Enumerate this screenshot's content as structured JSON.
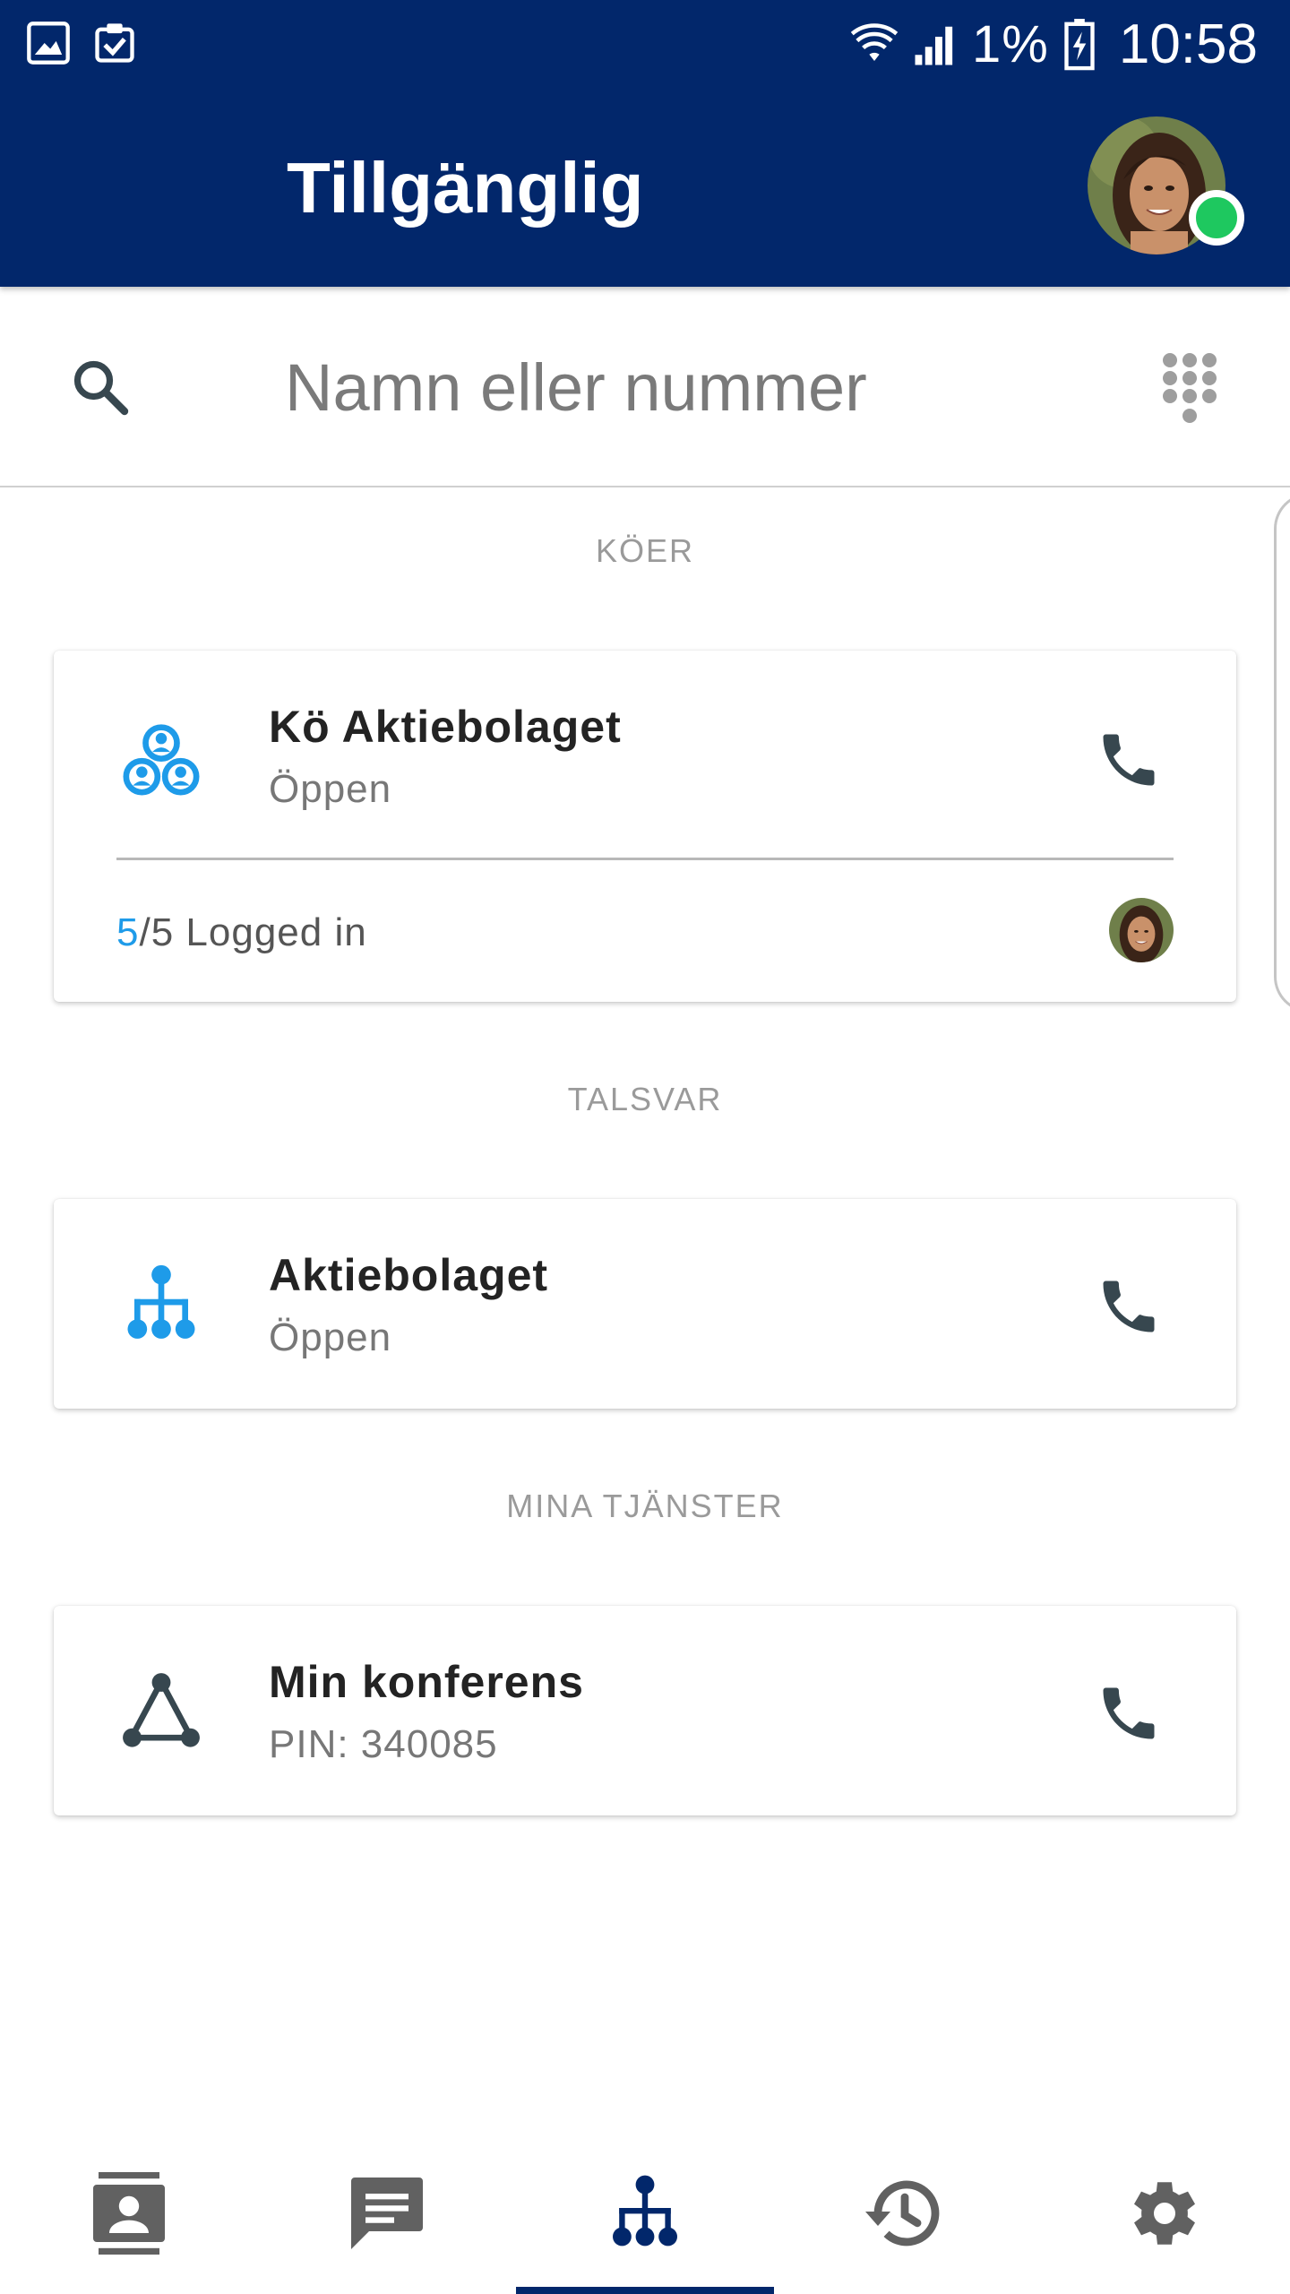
{
  "status_bar": {
    "battery_percent": "1%",
    "time": "10:58",
    "icons": [
      "image-icon",
      "clipboard-check-icon",
      "wifi-icon",
      "signal-icon",
      "battery-charging-icon"
    ]
  },
  "header": {
    "title": "Tillgänglig",
    "presence_color": "#1ec85f"
  },
  "search": {
    "placeholder": "Namn eller nummer",
    "value": ""
  },
  "sections": {
    "queues_label": "KÖER",
    "voicemail_label": "TALSVAR",
    "services_label": "MINA TJÄNSTER"
  },
  "queue_card": {
    "title": "Kö Aktiebolaget",
    "status": "Öppen",
    "logged_in_count": "5",
    "logged_in_rest": "/5 Logged in",
    "icon": "group-icon"
  },
  "voicemail_card": {
    "title": "Aktiebolaget",
    "status": "Öppen",
    "icon": "org-tree-icon"
  },
  "conference_card": {
    "title": "Min konferens",
    "pin": "PIN: 340085",
    "icon": "triangle-nodes-icon"
  },
  "bottom_nav": {
    "items": [
      "contacts-icon",
      "chat-icon",
      "org-tree-icon",
      "history-icon",
      "settings-icon"
    ],
    "active_index": 2
  },
  "colors": {
    "header_bg": "#02276b",
    "accent_blue": "#1e9be9",
    "icon_dark": "#37474f",
    "nav_inactive": "#616161"
  }
}
